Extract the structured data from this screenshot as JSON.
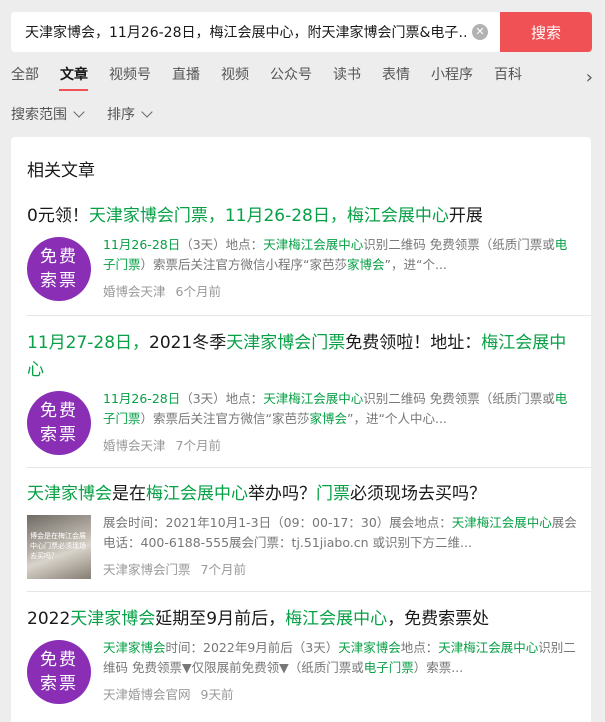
{
  "search": {
    "query": "天津家博会，11月26-28日，梅江会展中心，附天津家博会门票&电子…",
    "button": "搜索"
  },
  "tabs": [
    "全部",
    "文章",
    "视频号",
    "直播",
    "视频",
    "公众号",
    "读书",
    "表情",
    "小程序",
    "百科"
  ],
  "active_tab": "文章",
  "filters": {
    "range": "搜索范围",
    "sort": "排序"
  },
  "section_title": "相关文章",
  "colors": {
    "accent": "#f05154",
    "highlight": "#07a046",
    "badge": "#8a2fb5"
  },
  "articles": [
    {
      "title_parts": [
        "0元领！",
        "天津家博会门票，11月26-28日，梅江会展中心",
        "开展"
      ],
      "snippet_parts": [
        "11月26-28日",
        "（3天）地点：",
        "天津梅江会展中心",
        "识别二维码 免费领票（纸质门票或",
        "电子门票",
        "）索票后关注官方微信小程序“家芭莎",
        "家博会",
        "”，进“个..."
      ],
      "thumb": {
        "line1": "免费",
        "line2": "索票"
      },
      "source": "婚博会天津",
      "time": "6个月前"
    },
    {
      "title_parts": [
        "11月27-28日，",
        "2021冬季",
        "天津家博会门票",
        "免费领啦！地址：",
        "梅江会展中心"
      ],
      "snippet_parts": [
        "11月26-28日",
        "（3天）地点：",
        "天津梅江会展中心",
        "识别二维码 免费领票（纸质门票或",
        "电子门票",
        "）索票后关注官方微信“家芭莎",
        "家博会",
        "”，进“个人中心..."
      ],
      "thumb": {
        "line1": "免费",
        "line2": "索票"
      },
      "source": "婚博会天津",
      "time": "7个月前"
    },
    {
      "title_parts": [
        "天津家博会",
        "是在",
        "梅江会展中心",
        "举办吗？",
        "门票",
        "必须现场去买吗？"
      ],
      "snippet_parts": [
        "展会时间：2021年10月1-3日（09：00-17：30）展会地点：",
        "天津梅江会展中心",
        "展会电话：400-6188-555展会门票：tj.51jiabo.cn 或识别下方二维..."
      ],
      "thumb": {
        "caption": "博会是在梅江会展中心门票必须现场去买吗？"
      },
      "source": "天津家博会门票",
      "time": "7个月前"
    },
    {
      "title_parts": [
        "2022",
        "天津家博会",
        "延期至9月前后，",
        "梅江会展中心",
        "，免费索票处"
      ],
      "snippet_parts": [
        "天津家博会",
        "时间：2022年9月前后（3天）",
        "天津家博会",
        "地点：",
        "天津梅江会展中心",
        "识别二维码 免费领票▼仅限展前免费领▼（纸质门票或",
        "电子门票",
        "）索票..."
      ],
      "thumb": {
        "line1": "免费",
        "line2": "索票"
      },
      "source": "天津婚博会官网",
      "time": "9天前"
    }
  ]
}
